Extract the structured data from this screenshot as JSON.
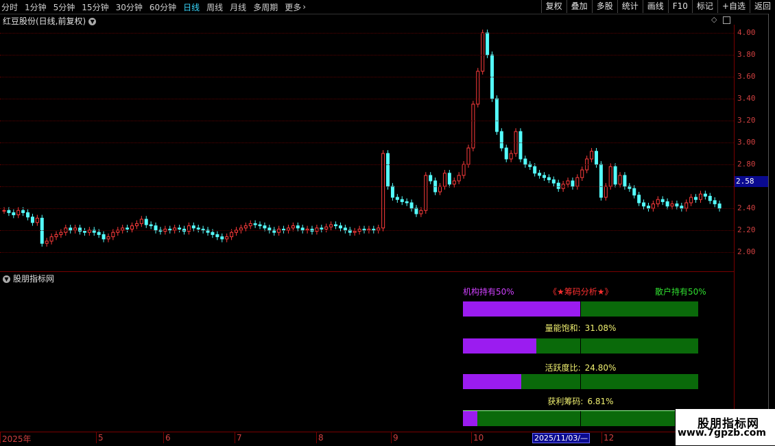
{
  "toolbar": {
    "periods": [
      "分时",
      "1分钟",
      "5分钟",
      "15分钟",
      "30分钟",
      "60分钟",
      "日线",
      "周线",
      "月线",
      "多周期",
      "更多"
    ],
    "active_period": "日线",
    "buttons": [
      "复权",
      "叠加",
      "多股",
      "统计",
      "画线",
      "F10",
      "标记",
      "+自选",
      "返回"
    ]
  },
  "stock": {
    "title": "红豆股份(日线,前复权)"
  },
  "price_axis": {
    "labels": [
      "4.00",
      "3.80",
      "3.60",
      "3.40",
      "3.20",
      "3.00",
      "2.80",
      "2.60",
      "2.40",
      "2.20",
      "2.00"
    ],
    "current": "2.58"
  },
  "indicator": {
    "panel_title": "股朋指标网",
    "institution_label": "机构持有50%",
    "analysis_title": "《★筹码分析★》",
    "retail_label": "散户持有50%",
    "institution_fraction": 0.5,
    "stats": [
      {
        "name": "量能饱和:",
        "value": "31.08%",
        "fraction": 0.3108
      },
      {
        "name": "活跃度比:",
        "value": "24.80%",
        "fraction": 0.248
      },
      {
        "name": "获利筹码:",
        "value": "6.81%",
        "fraction": 0.0681
      }
    ]
  },
  "x_axis": {
    "labels": [
      "2025年",
      "5",
      "6",
      "7",
      "8",
      "9",
      "10",
      "12"
    ],
    "cursor_date": "2025/11/03/—"
  },
  "watermark": {
    "title": "股朋指标网",
    "url": "www.7gpzb.com"
  },
  "colors": {
    "up": "#ff3c3c",
    "down": "#54fcfc",
    "institution": "#9b1cf0",
    "retail": "#0a6a0a"
  },
  "chart_data": {
    "type": "candlestick",
    "ylim": [
      1.9,
      4.05
    ],
    "close_series": [
      2.38,
      2.36,
      2.34,
      2.38,
      2.36,
      2.32,
      2.27,
      2.31,
      2.08,
      2.1,
      2.14,
      2.16,
      2.18,
      2.22,
      2.2,
      2.22,
      2.19,
      2.18,
      2.2,
      2.18,
      2.16,
      2.12,
      2.14,
      2.18,
      2.2,
      2.22,
      2.21,
      2.24,
      2.26,
      2.3,
      2.25,
      2.24,
      2.2,
      2.19,
      2.21,
      2.2,
      2.22,
      2.21,
      2.19,
      2.24,
      2.22,
      2.21,
      2.2,
      2.18,
      2.16,
      2.14,
      2.12,
      2.14,
      2.18,
      2.2,
      2.22,
      2.24,
      2.26,
      2.25,
      2.24,
      2.22,
      2.2,
      2.18,
      2.21,
      2.2,
      2.22,
      2.24,
      2.22,
      2.2,
      2.21,
      2.19,
      2.22,
      2.21,
      2.23,
      2.25,
      2.24,
      2.22,
      2.2,
      2.18,
      2.19,
      2.21,
      2.2,
      2.21,
      2.2,
      2.22,
      2.9,
      2.6,
      2.5,
      2.48,
      2.46,
      2.45,
      2.4,
      2.35,
      2.38,
      2.7,
      2.65,
      2.55,
      2.6,
      2.72,
      2.62,
      2.65,
      2.7,
      2.8,
      2.95,
      3.35,
      3.65,
      4.0,
      3.8,
      3.4,
      3.1,
      2.95,
      2.85,
      2.9,
      3.1,
      2.85,
      2.8,
      2.78,
      2.72,
      2.7,
      2.68,
      2.66,
      2.63,
      2.58,
      2.62,
      2.65,
      2.6,
      2.68,
      2.75,
      2.85,
      2.92,
      2.8,
      2.5,
      2.6,
      2.78,
      2.62,
      2.7,
      2.6,
      2.58,
      2.52,
      2.45,
      2.42,
      2.4,
      2.44,
      2.48,
      2.46,
      2.42,
      2.44,
      2.42,
      2.4,
      2.45,
      2.5,
      2.48,
      2.53,
      2.51,
      2.47,
      2.44,
      2.4
    ]
  }
}
